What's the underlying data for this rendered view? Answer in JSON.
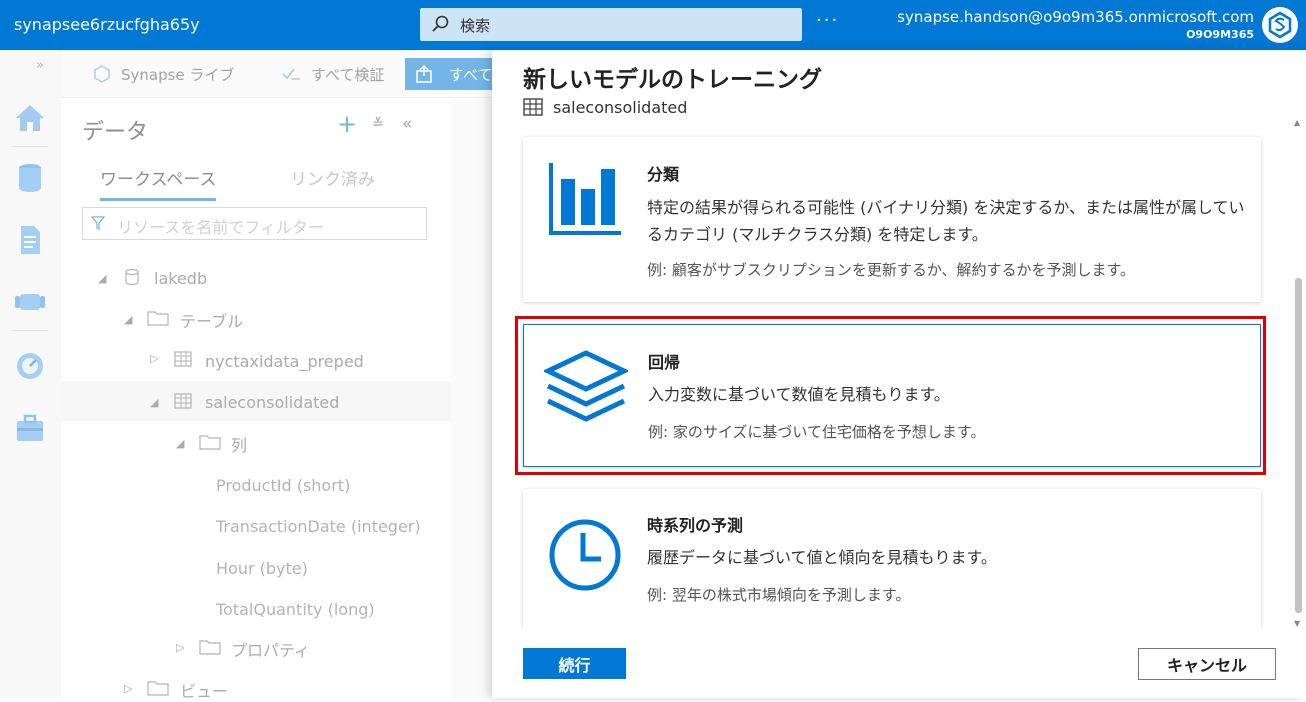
{
  "topbar": {
    "workspace": "synapsee6rzucfgha65y",
    "search_placeholder": "検索",
    "more": "···",
    "email": "synapse.handson@o9o9m365.onmicrosoft.com",
    "tenant": "O9O9M365"
  },
  "cmdbar": {
    "synapse_live": "Synapse ライブ",
    "validate_all": "すべて検証",
    "publish_all": "すべて"
  },
  "data_pane": {
    "header": "データ",
    "tabs": [
      "ワークスペース",
      "リンク済み"
    ],
    "filter_placeholder": "リソースを名前でフィルター",
    "tree": {
      "lakedb": "lakedb",
      "tables": "テーブル",
      "t1": "nyctaxidata_preped",
      "t2": "saleconsolidated",
      "columns": "列",
      "c1": "ProductId (short)",
      "c2": "TransactionDate (integer)",
      "c3": "Hour (byte)",
      "c4": "TotalQuantity (long)",
      "properties": "プロパティ",
      "views": "ビュー"
    }
  },
  "panel": {
    "title": "新しいモデルのトレーニング",
    "table": "saleconsolidated",
    "cards": [
      {
        "title": "分類",
        "desc": "特定の結果が得られる可能性 (バイナリ分類) を決定するか、または属性が属しているカテゴリ (マルチクラス分類) を特定します。",
        "example": "例: 顧客がサブスクリプションを更新するか、解約するかを予測します。"
      },
      {
        "title": "回帰",
        "desc": "入力変数に基づいて数値を見積もります。",
        "example": "例: 家のサイズに基づいて住宅価格を予想します。"
      },
      {
        "title": "時系列の予測",
        "desc": "履歴データに基づいて値と傾向を見積もります。",
        "example": "例: 翌年の株式市場傾向を予測します。"
      }
    ],
    "continue": "続行",
    "cancel": "キャンセル"
  },
  "colors": {
    "accent": "#0078d4",
    "highlight": "#e00000"
  }
}
